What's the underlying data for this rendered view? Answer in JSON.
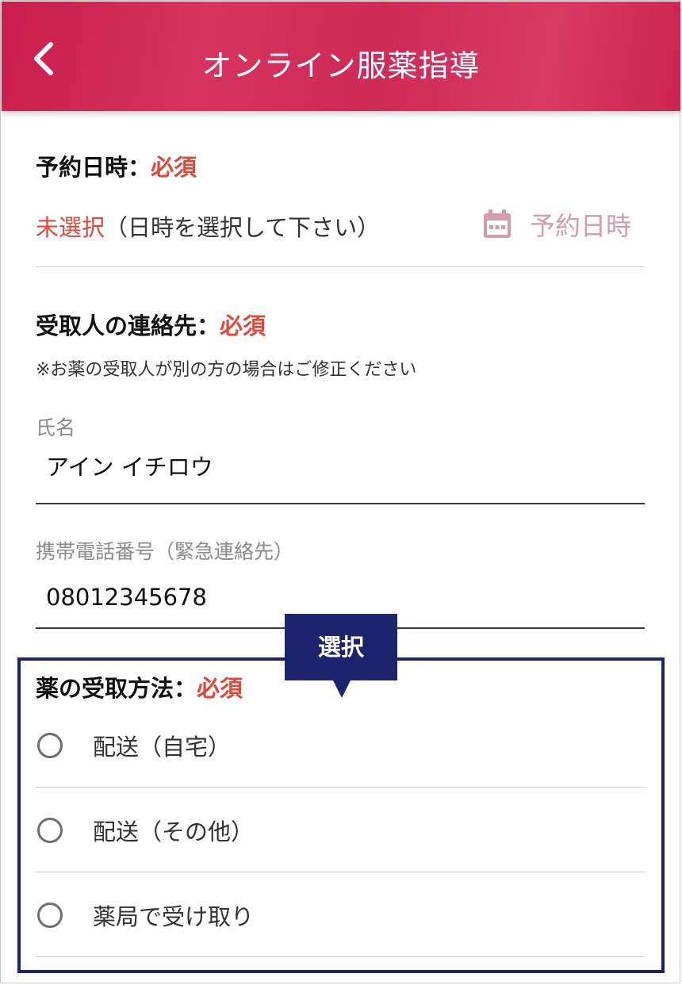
{
  "header": {
    "title": "オンライン服薬指導",
    "back_icon": "chevron-left-icon"
  },
  "reservation": {
    "title": "予約日時：",
    "required": "必須",
    "status": "未選択",
    "hint": "（日時を選択して下さい）",
    "button_label": "予約日時",
    "button_icon": "calendar-icon"
  },
  "recipient": {
    "title": "受取人の連絡先：",
    "required": "必須",
    "note": "※お薬の受取人が別の方の場合はご修正ください",
    "name_label": "氏名",
    "name_value": "アイン イチロウ",
    "phone_label": "携帯電話番号（緊急連絡先）",
    "phone_value": "08012345678"
  },
  "callout": {
    "label": "選択"
  },
  "method": {
    "title": "薬の受取方法：",
    "required": "必須",
    "options": [
      {
        "label": "配送（自宅）",
        "selected": false
      },
      {
        "label": "配送（その他）",
        "selected": false
      },
      {
        "label": "薬局で受け取り",
        "selected": false
      }
    ]
  },
  "colors": {
    "brand": "#cf2a57",
    "required": "#e0483a",
    "accent_pink": "#d59aae",
    "callout_navy": "#1d236d"
  }
}
